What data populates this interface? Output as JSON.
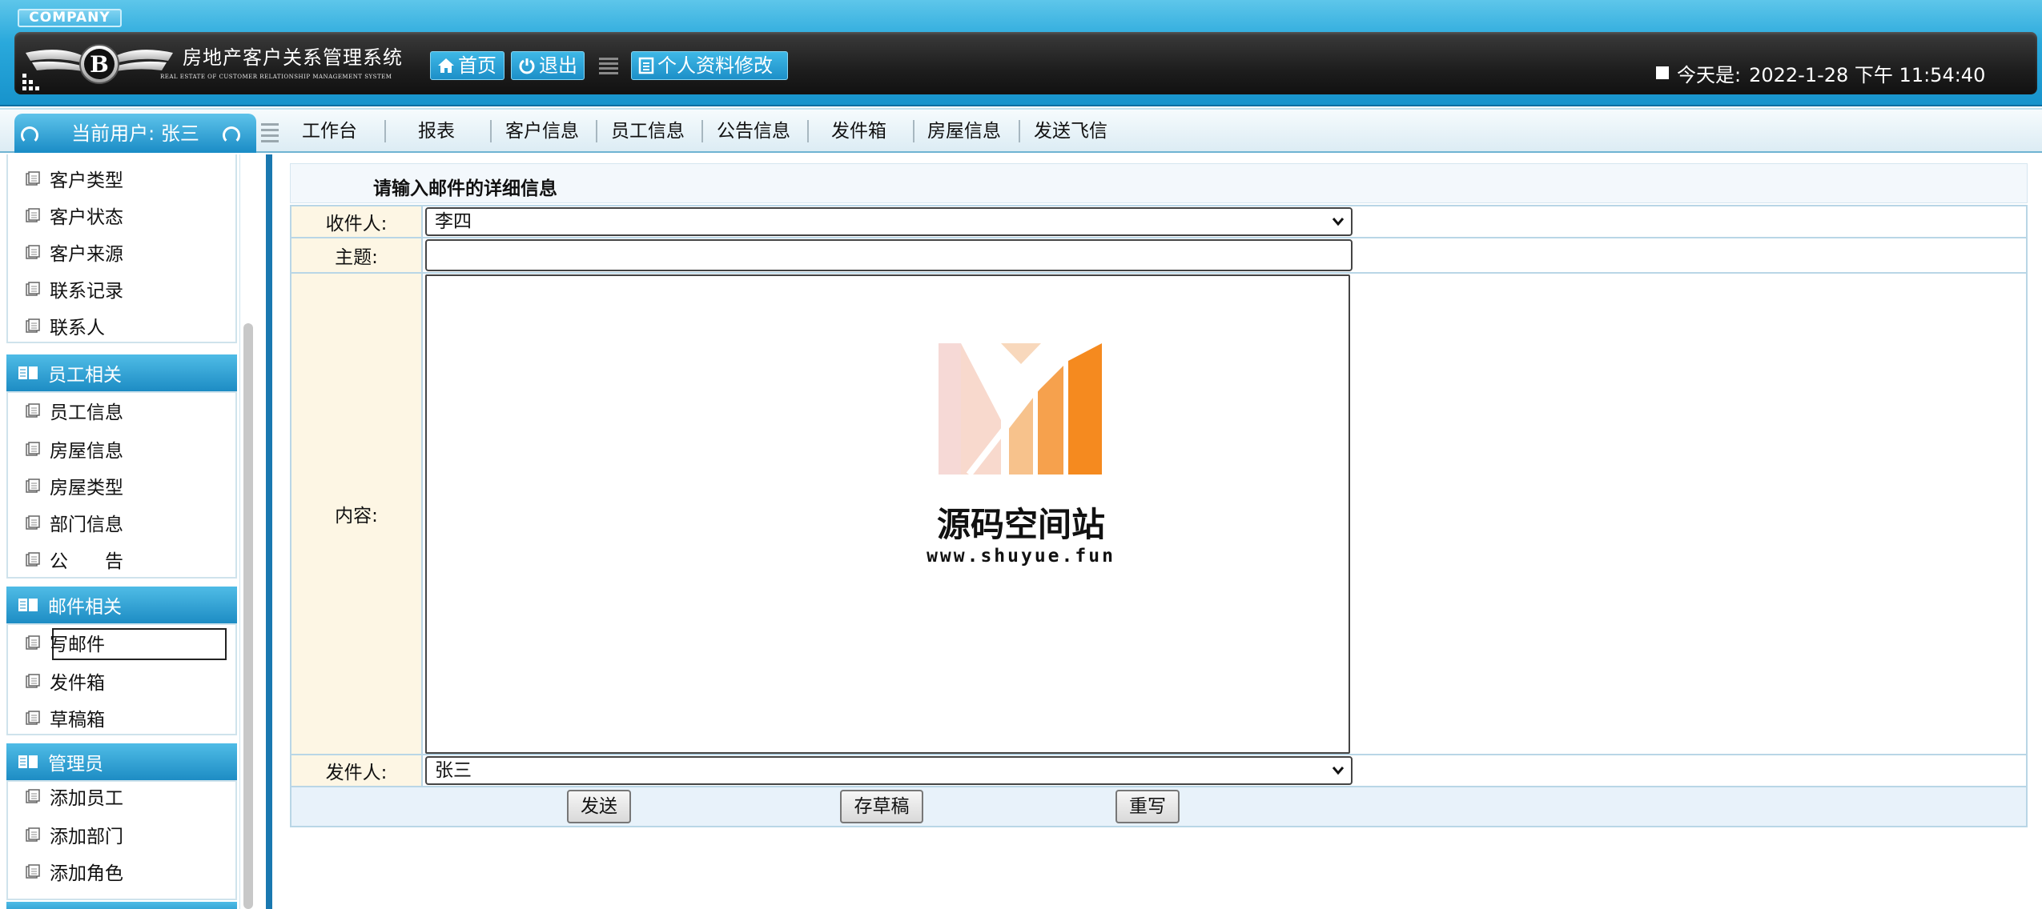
{
  "header": {
    "company": "COMPANY",
    "system_title": "房地产客户关系管理系统",
    "system_title_en": "REAL ESTATE OF CUSTOMER RELATIONSHIP MANAGEMENT SYSTEM",
    "home_label": "首页",
    "logout_label": "退出",
    "profile_label": "个人资料修改",
    "date_label": "今天是:",
    "date_value": "2022-1-28 下午 11:54:40"
  },
  "nav": {
    "current_user": "当前用户: 张三",
    "items": [
      "工作台",
      "报表",
      "客户信息",
      "员工信息",
      "公告信息",
      "发件箱",
      "房屋信息",
      "发送飞信"
    ]
  },
  "sidebar": {
    "group_customer_items": [
      "客户类型",
      "客户状态",
      "客户来源",
      "联系记录",
      "联系人"
    ],
    "group_staff": {
      "title": "员工相关",
      "items": [
        "员工信息",
        "房屋信息",
        "房屋类型",
        "部门信息",
        "公　　告"
      ]
    },
    "group_mail": {
      "title": "邮件相关",
      "items": [
        "写邮件",
        "发件箱",
        "草稿箱"
      ]
    },
    "group_admin": {
      "title": "管理员",
      "items": [
        "添加员工",
        "添加部门",
        "添加角色"
      ]
    }
  },
  "form": {
    "title": "请输入邮件的详细信息",
    "recipient_label": "收件人:",
    "recipient_value": "李四",
    "subject_label": "主题:",
    "subject_value": "",
    "content_label": "内容:",
    "sender_label": "发件人:",
    "sender_value": "张三",
    "send_button": "发送",
    "draft_button": "存草稿",
    "reset_button": "重写"
  },
  "watermark": {
    "name": "源码空间站",
    "url": "www.shuyue.fun"
  }
}
